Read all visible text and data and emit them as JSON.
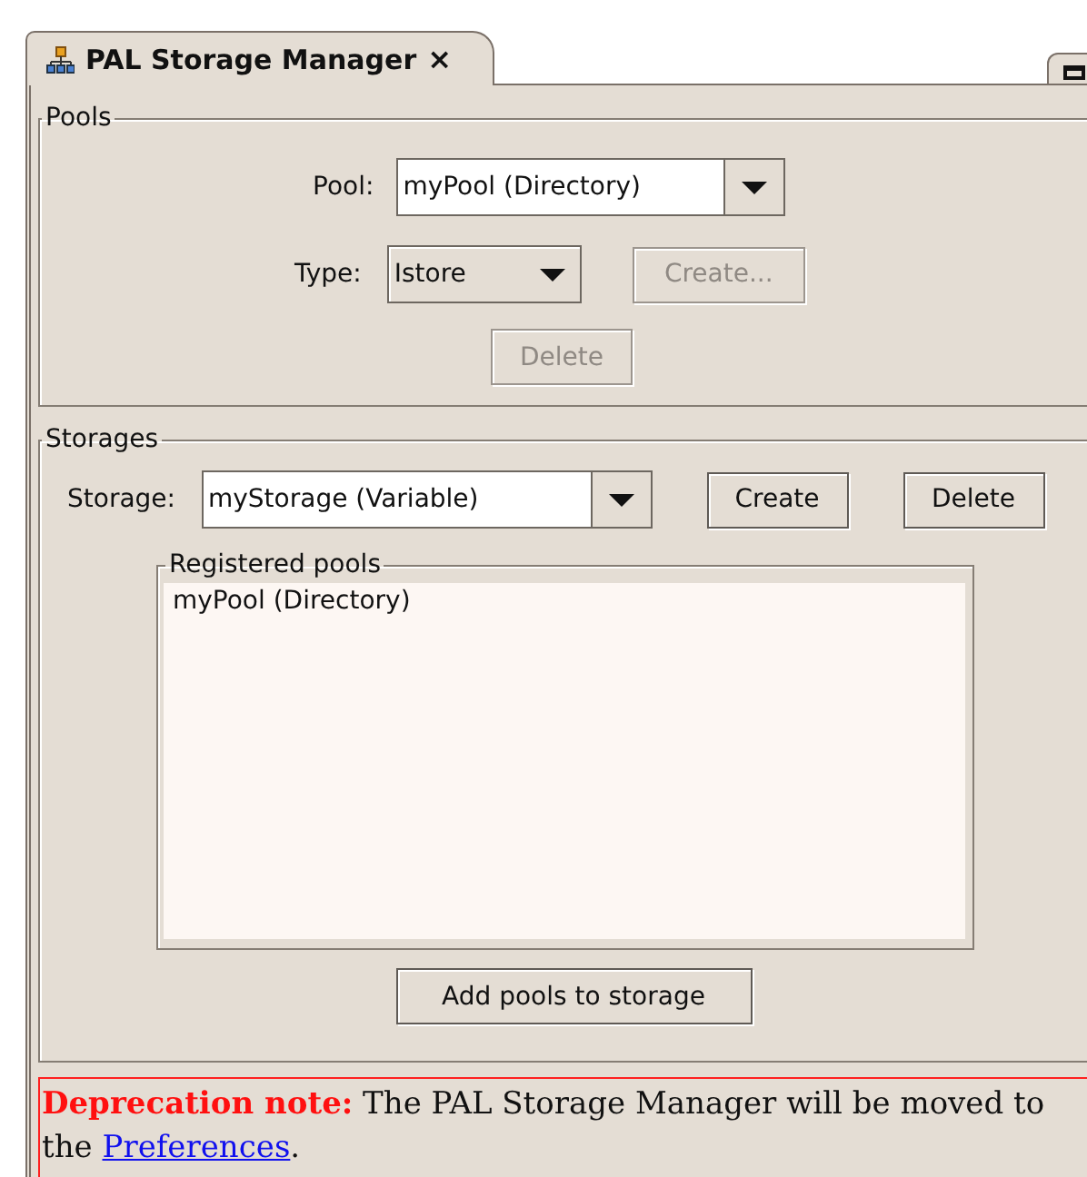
{
  "tab": {
    "title": "PAL Storage Manager",
    "close": "×",
    "selected": true
  },
  "pools": {
    "legend": "Pools",
    "pool_label": "Pool:",
    "pool_value": "myPool (Directory)",
    "type_label": "Type:",
    "type_value": "Istore",
    "buttons": [
      {
        "label": "Create...",
        "disabled": true
      },
      {
        "label": "Delete",
        "disabled": true
      }
    ]
  },
  "storages": {
    "legend": "Storages",
    "storage_label": "Storage:",
    "storage_value": "myStorage (Variable)",
    "buttons": [
      {
        "label": "Create",
        "disabled": false
      },
      {
        "label": "Delete",
        "disabled": false
      }
    ],
    "registered": {
      "legend": "Registered pools",
      "items": [
        "myPool (Directory)"
      ]
    },
    "add_button": {
      "label": "Add pools to storage",
      "disabled": false
    }
  },
  "note": {
    "label": "Deprecation note:",
    "text": " The PAL Storage Manager will be moved to the ",
    "link": "Preferences",
    "suffix": "."
  }
}
